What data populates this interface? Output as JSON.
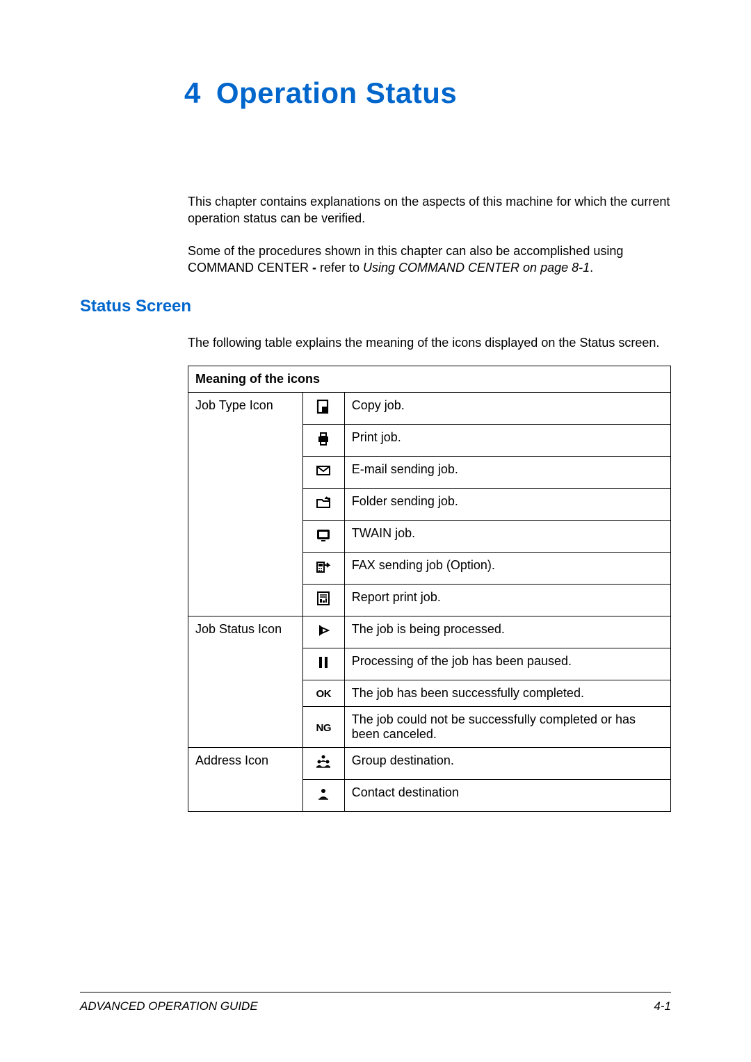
{
  "chapter": {
    "number": "4",
    "title": "Operation Status"
  },
  "intro": {
    "p1": "This chapter contains explanations on the aspects of this machine for which the current operation status can be verified.",
    "p2a": "Some of the procedures shown in this chapter can also be accomplished using COMMAND CENTER ",
    "p2b": "- ",
    "p2c": "refer to ",
    "p2ref": "Using COMMAND CENTER on page 8-1",
    "p2d": "."
  },
  "section": {
    "heading": "Status Screen"
  },
  "table": {
    "intro": "The following table explains the meaning of the icons displayed on the Status screen.",
    "header": "Meaning of the icons",
    "groups": [
      {
        "label": "Job Type Icon",
        "rows": [
          {
            "icon": "copy",
            "desc": "Copy job."
          },
          {
            "icon": "print",
            "desc": "Print job."
          },
          {
            "icon": "email",
            "desc": "E-mail sending job."
          },
          {
            "icon": "folder",
            "desc": "Folder sending job."
          },
          {
            "icon": "twain",
            "desc": "TWAIN job."
          },
          {
            "icon": "fax",
            "desc": "FAX sending job (Option)."
          },
          {
            "icon": "report",
            "desc": "Report print job."
          }
        ]
      },
      {
        "label": "Job Status Icon",
        "rows": [
          {
            "icon": "processing",
            "desc": "The job is being processed."
          },
          {
            "icon": "paused",
            "desc": "Processing of the job has been paused."
          },
          {
            "icon": "ok",
            "desc": "The job has been successfully completed."
          },
          {
            "icon": "ng",
            "desc": "The job could not be successfully completed or has been canceled."
          }
        ]
      },
      {
        "label": "Address Icon",
        "rows": [
          {
            "icon": "group",
            "desc": "Group destination."
          },
          {
            "icon": "contact",
            "desc": "Contact destination"
          }
        ]
      }
    ]
  },
  "footer": {
    "left": "ADVANCED OPERATION GUIDE",
    "right": "4-1"
  }
}
